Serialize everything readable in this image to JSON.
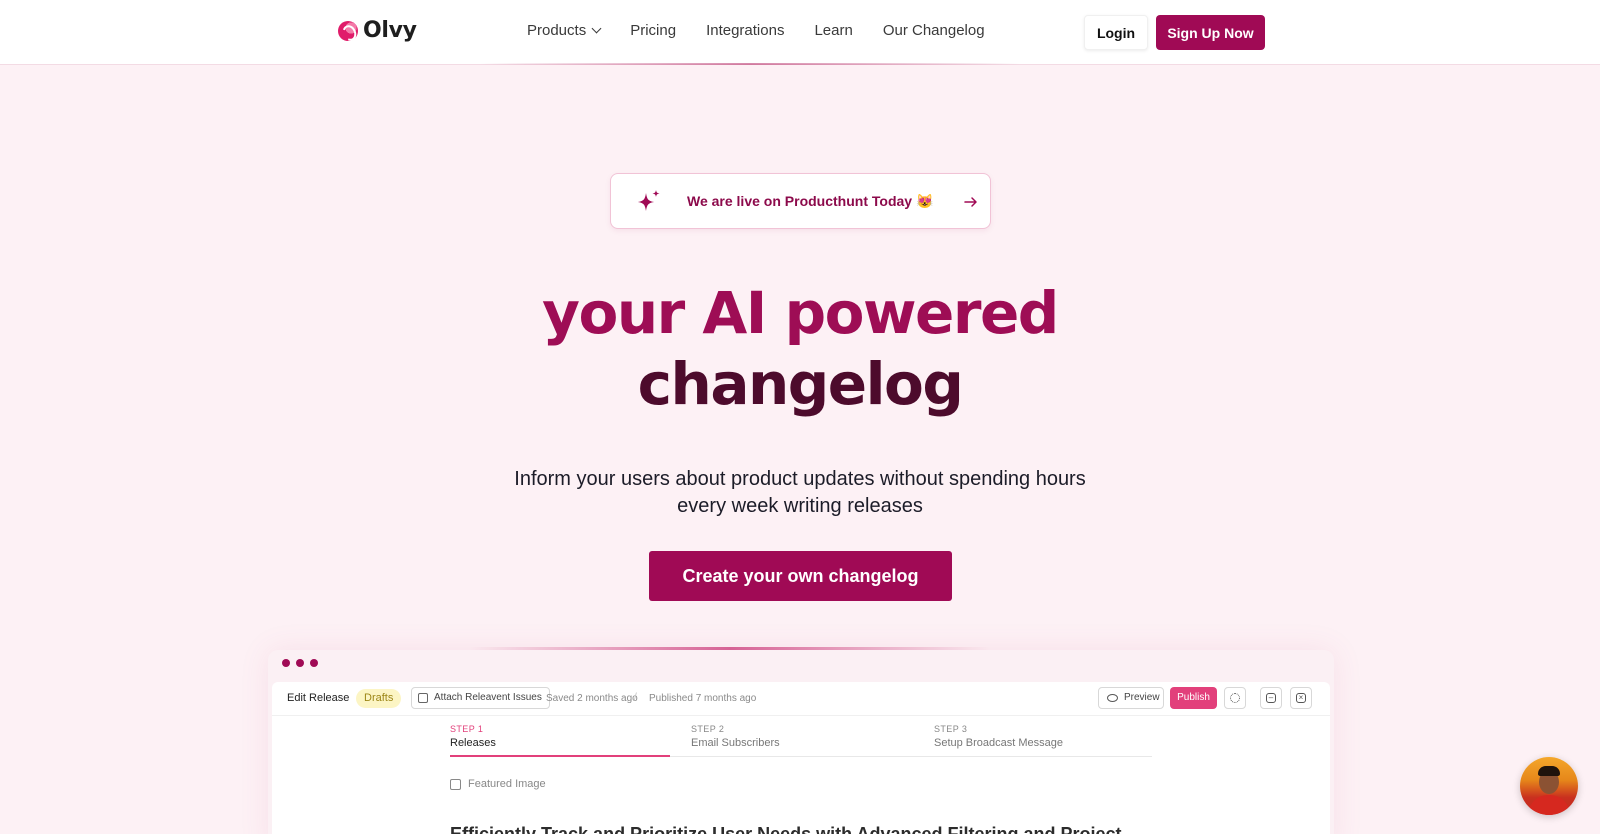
{
  "header": {
    "brand": "Olvy",
    "nav": [
      {
        "label": "Products",
        "has_dropdown": true
      },
      {
        "label": "Pricing"
      },
      {
        "label": "Integrations"
      },
      {
        "label": "Learn"
      },
      {
        "label": "Our Changelog"
      }
    ],
    "login_label": "Login",
    "signup_label": "Sign Up Now"
  },
  "announcement": {
    "text": "We are live on Producthunt Today 😻",
    "icon": "sparkle-icon",
    "arrow": "arrow-right-icon"
  },
  "hero": {
    "title_line1": "your AI powered",
    "title_line2": "changelog",
    "subtitle": "Inform your users about product updates without spending hours every week writing releases",
    "cta_label": "Create your own changelog"
  },
  "preview": {
    "toolbar": {
      "edit_release": "Edit Release",
      "status_badge": "Drafts",
      "attach_label": "Attach Releavent Issues",
      "saved": "Saved 2 months ago",
      "separator": "/",
      "published": "Published 7 months ago",
      "preview_label": "Preview",
      "publish_label": "Publish"
    },
    "steps": [
      {
        "step": "STEP 1",
        "label": "Releases",
        "active": true
      },
      {
        "step": "STEP 2",
        "label": "Email Subscribers",
        "active": false
      },
      {
        "step": "STEP 3",
        "label": "Setup Broadcast Message",
        "active": false
      }
    ],
    "featured_image_label": "Featured Image",
    "release_title": "Efficiently Track and Prioritize User Needs with Advanced Filtering and Project"
  },
  "colors": {
    "brand": "#a00a55",
    "accent": "#e2407b",
    "background": "#fdf1f5"
  }
}
